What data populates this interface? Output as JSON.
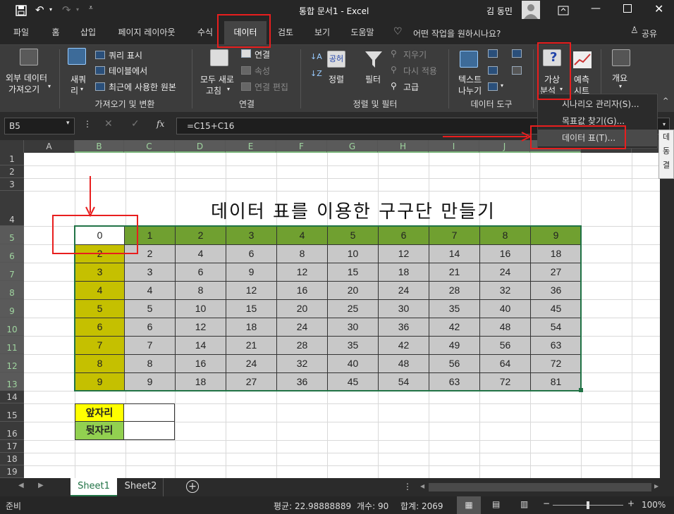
{
  "window": {
    "title": "통합 문서1  -  Excel",
    "user": "김 동민",
    "save_icon": "save-icon",
    "undo_icon": "undo-icon",
    "redo_icon": "redo-icon"
  },
  "tabs": [
    "파일",
    "홈",
    "삽입",
    "페이지 레이아웃",
    "수식",
    "데이터",
    "검토",
    "보기",
    "도움말"
  ],
  "active_tab": "데이터",
  "tell_me": "어떤 작업을 원하시나요?",
  "share": "공유",
  "ribbon": {
    "get_external_line1": "외부 데이터",
    "get_external_line2": "가져오기",
    "new_query_line1": "새쿼",
    "new_query_line2": "리",
    "query_items": [
      "쿼리 표시",
      "테이블에서",
      "최근에 사용한 원본"
    ],
    "group_get": "가져오기 및 변환",
    "refresh_line1": "모두 새로",
    "refresh_line2": "고침",
    "conn_items": [
      "연결",
      "속성",
      "연결 편집"
    ],
    "group_conn": "연결",
    "sort": "정렬",
    "filter": "필터",
    "filter_items": [
      "지우기",
      "다시 적용",
      "고급"
    ],
    "group_sort": "정렬 및 필터",
    "text_to_col_line1": "텍스트",
    "text_to_col_line2": "나누기",
    "group_tools": "데이터 도구",
    "whatif_line1": "가상",
    "whatif_line2": "분석",
    "forecast_line1": "예측",
    "forecast_line2": "시트",
    "outline": "개요"
  },
  "whatif_menu": [
    "시나리오 관리자(S)...",
    "목표값 찾기(G)...",
    "데이터 표(T)..."
  ],
  "side_tooltip": [
    "데",
    "동",
    "결"
  ],
  "formula": {
    "name_box": "B5",
    "fx": "fx",
    "content": "=C15+C16"
  },
  "columns": [
    "A",
    "B",
    "C",
    "D",
    "E",
    "F",
    "G",
    "H",
    "I",
    "J",
    "K",
    "L"
  ],
  "rows": [
    "1",
    "2",
    "3",
    "4",
    "5",
    "6",
    "7",
    "8",
    "9",
    "10",
    "11",
    "12",
    "13",
    "14",
    "15",
    "16",
    "17",
    "18",
    "19"
  ],
  "sheet_title": "데이터 표를 이용한 구구단 만들기",
  "table": {
    "corner": "0",
    "header": [
      "1",
      "2",
      "3",
      "4",
      "5",
      "6",
      "7",
      "8",
      "9"
    ],
    "row_labels": [
      "2",
      "3",
      "4",
      "5",
      "6",
      "7",
      "8",
      "9"
    ],
    "cells": [
      [
        "2",
        "4",
        "6",
        "8",
        "10",
        "12",
        "14",
        "16",
        "18"
      ],
      [
        "3",
        "6",
        "9",
        "12",
        "15",
        "18",
        "21",
        "24",
        "27"
      ],
      [
        "4",
        "8",
        "12",
        "16",
        "20",
        "24",
        "28",
        "32",
        "36"
      ],
      [
        "5",
        "10",
        "15",
        "20",
        "25",
        "30",
        "35",
        "40",
        "45"
      ],
      [
        "6",
        "12",
        "18",
        "24",
        "30",
        "36",
        "42",
        "48",
        "54"
      ],
      [
        "7",
        "14",
        "21",
        "28",
        "35",
        "42",
        "49",
        "56",
        "63"
      ],
      [
        "8",
        "16",
        "24",
        "32",
        "40",
        "48",
        "56",
        "64",
        "72"
      ],
      [
        "9",
        "18",
        "27",
        "36",
        "45",
        "54",
        "63",
        "72",
        "81"
      ]
    ]
  },
  "inputs": {
    "front_label": "앞자리",
    "back_label": "뒷자리",
    "front_value": "",
    "back_value": ""
  },
  "sheets": [
    "Sheet1",
    "Sheet2"
  ],
  "status": {
    "ready": "준비",
    "average": "평균: 22.98888889",
    "count": "개수: 90",
    "sum": "합계: 2069",
    "zoom": "100%"
  },
  "colors": {
    "header_green": "#70a030",
    "rowlabel_olive": "#c5c000",
    "cells_gray": "#c8c8c8",
    "front_yellow": "#ffff00",
    "back_green": "#92d050",
    "highlight_red": "#e81e1e"
  }
}
